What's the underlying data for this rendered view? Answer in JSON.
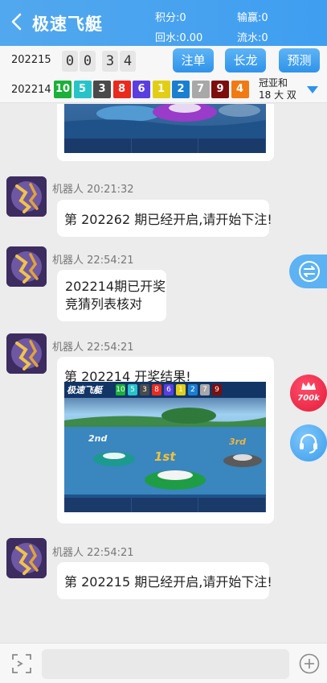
{
  "header": {
    "title": "极速飞艇",
    "points_label": "积分:0",
    "winloss_label": "输赢:0",
    "rebate_label": "回水:0.00",
    "turnover_label": "流水:0"
  },
  "countdown": {
    "current_period": "202215",
    "digits": [
      "0",
      "0",
      "3",
      "4"
    ]
  },
  "actions": {
    "bet_label": "注单",
    "dragon_label": "长龙",
    "predict_label": "预测"
  },
  "last_result": {
    "period": "202214",
    "balls": [
      {
        "num": "10",
        "color": "#1bb03a"
      },
      {
        "num": "5",
        "color": "#26c4c9"
      },
      {
        "num": "3",
        "color": "#4a4a4a"
      },
      {
        "num": "8",
        "color": "#ea2a1d"
      },
      {
        "num": "6",
        "color": "#5b3ee0"
      },
      {
        "num": "1",
        "color": "#e2cf15"
      },
      {
        "num": "2",
        "color": "#1a7fd0"
      },
      {
        "num": "7",
        "color": "#a8a8a8"
      },
      {
        "num": "9",
        "color": "#7d0e0e"
      },
      {
        "num": "4",
        "color": "#f07a14"
      }
    ],
    "summary_line1": "冠亚和",
    "summary_line2": "18 大 双"
  },
  "messages": [
    {
      "sender": "机器人",
      "time": "20:21:32",
      "text": "第 202262 期已经开启,请开始下注!"
    },
    {
      "sender": "机器人",
      "time": "22:54:21",
      "text_line1": "202214期已开奖",
      "text_line2": "竞猜列表核对"
    },
    {
      "sender": "机器人",
      "time": "22:54:21",
      "text": "第 202214 开奖结果!"
    },
    {
      "sender": "机器人",
      "time": "22:54:21",
      "text": "第 202215 期已经开启,请开始下注!"
    }
  ],
  "race_image": {
    "title": "极速飞艇",
    "top_balls": [
      "10",
      "5",
      "3",
      "8",
      "6",
      "1",
      "2",
      "7",
      "9"
    ],
    "first_label": "1st",
    "second_label": "2nd",
    "third_label": "3rd"
  },
  "floats": {
    "redpacket_label": "700k"
  },
  "input": {
    "placeholder": ""
  },
  "colors": {
    "header_start": "#52a8ee",
    "header_end": "#3f9ef0",
    "accent": "#3f9ef0"
  }
}
